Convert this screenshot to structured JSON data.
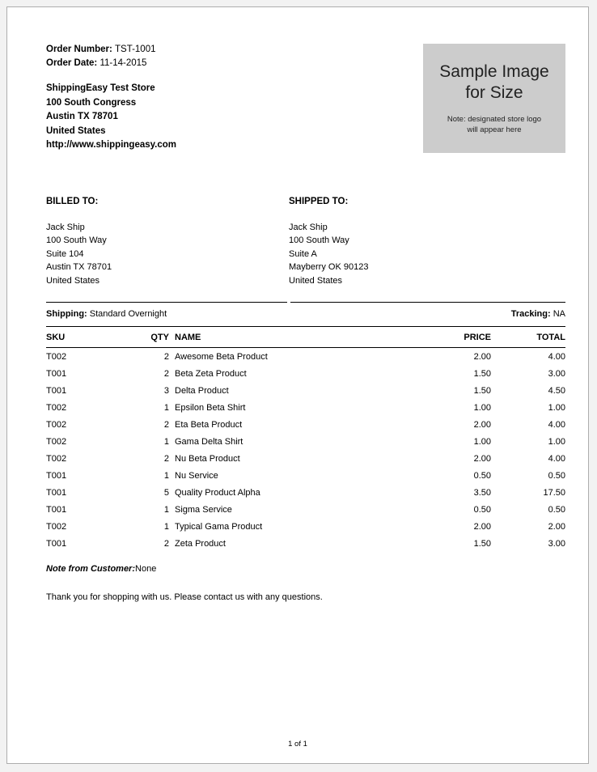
{
  "order": {
    "number_label": "Order Number:",
    "number_value": "TST-1001",
    "date_label": "Order Date:",
    "date_value": "11-14-2015"
  },
  "store": {
    "name": "ShippingEasy Test Store",
    "street": "100 South Congress",
    "city_state_zip": "Austin TX 78701",
    "country": "United States",
    "website": "http://www.shippingeasy.com"
  },
  "logo": {
    "title_line1": "Sample Image",
    "title_line2": "for Size",
    "note_line1": "Note: designated store logo",
    "note_line2": "will appear here",
    "background_color": "#cccccc"
  },
  "billed_to": {
    "title": "BILLED TO:",
    "lines": [
      "Jack Ship",
      "100 South Way",
      "Suite 104",
      "Austin TX 78701",
      "United States"
    ]
  },
  "shipped_to": {
    "title": "SHIPPED TO:",
    "lines": [
      "Jack Ship",
      "100 South Way",
      "Suite A",
      "Mayberry OK 90123",
      "United States"
    ]
  },
  "shipping": {
    "label": "Shipping:",
    "value": "Standard Overnight",
    "tracking_label": "Tracking:",
    "tracking_value": "NA"
  },
  "items_table": {
    "headers": {
      "sku": "SKU",
      "qty": "QTY",
      "name": "NAME",
      "price": "PRICE",
      "total": "TOTAL"
    },
    "rows": [
      {
        "sku": "T002",
        "qty": "2",
        "name": "Awesome Beta Product",
        "price": "2.00",
        "total": "4.00"
      },
      {
        "sku": "T001",
        "qty": "2",
        "name": "Beta Zeta Product",
        "price": "1.50",
        "total": "3.00"
      },
      {
        "sku": "T001",
        "qty": "3",
        "name": "Delta Product",
        "price": "1.50",
        "total": "4.50"
      },
      {
        "sku": "T002",
        "qty": "1",
        "name": "Epsilon Beta Shirt",
        "price": "1.00",
        "total": "1.00"
      },
      {
        "sku": "T002",
        "qty": "2",
        "name": "Eta Beta Product",
        "price": "2.00",
        "total": "4.00"
      },
      {
        "sku": "T002",
        "qty": "1",
        "name": "Gama Delta Shirt",
        "price": "1.00",
        "total": "1.00"
      },
      {
        "sku": "T002",
        "qty": "2",
        "name": "Nu Beta Product",
        "price": "2.00",
        "total": "4.00"
      },
      {
        "sku": "T001",
        "qty": "1",
        "name": "Nu Service",
        "price": "0.50",
        "total": "0.50"
      },
      {
        "sku": "T001",
        "qty": "5",
        "name": "Quality Product Alpha",
        "price": "3.50",
        "total": "17.50"
      },
      {
        "sku": "T001",
        "qty": "1",
        "name": "Sigma Service",
        "price": "0.50",
        "total": "0.50"
      },
      {
        "sku": "T002",
        "qty": "1",
        "name": "Typical Gama Product",
        "price": "2.00",
        "total": "2.00"
      },
      {
        "sku": "T001",
        "qty": "2",
        "name": "Zeta Product",
        "price": "1.50",
        "total": "3.00"
      }
    ]
  },
  "notes": {
    "customer_note_label": "Note from Customer:",
    "customer_note_value": "None",
    "thank_you": "Thank you for shopping with us. Please contact us with any questions."
  },
  "footer": {
    "page_indicator": "1 of 1"
  }
}
